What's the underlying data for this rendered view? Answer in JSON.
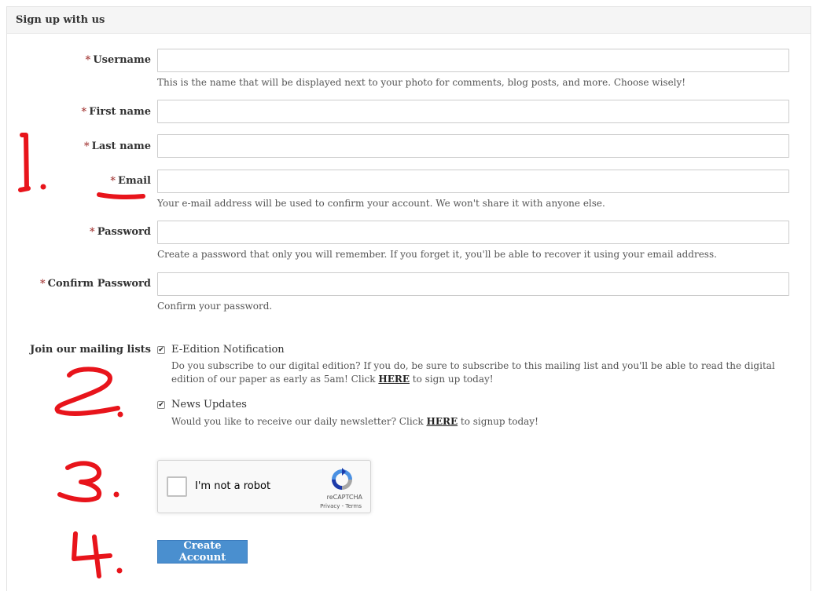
{
  "form": {
    "title": "Sign up with us",
    "required_marker": "*",
    "fields": {
      "username": {
        "label": "Username",
        "help": "This is the name that will be displayed next to your photo for comments, blog posts, and more. Choose wisely!",
        "value": ""
      },
      "first_name": {
        "label": "First name",
        "value": ""
      },
      "last_name": {
        "label": "Last name",
        "value": ""
      },
      "email": {
        "label": "Email",
        "help": "Your e-mail address will be used to confirm your account. We won't share it with anyone else.",
        "value": ""
      },
      "password": {
        "label": "Password",
        "help": "Create a password that only you will remember. If you forget it, you'll be able to recover it using your email address.",
        "value": ""
      },
      "confirm_password": {
        "label": "Confirm Password",
        "help": "Confirm your password.",
        "value": ""
      }
    },
    "mailing": {
      "label": "Join our mailing lists",
      "items": [
        {
          "label": "E-Edition Notification",
          "checked": true,
          "help_before": "Do you subscribe to our digital edition? If you do, be sure to subscribe to this mailing list and you'll be able to read the digital edition of our paper as early as 5am! Click ",
          "link": "HERE",
          "help_after": " to sign up today!"
        },
        {
          "label": "News Updates",
          "checked": true,
          "help_before": "Would you like to receive our daily newsletter? Click ",
          "link": "HERE",
          "help_after": " to signup today!"
        }
      ]
    },
    "recaptcha": {
      "text": "I'm not a robot",
      "brand": "reCAPTCHA",
      "links": "Privacy - Terms"
    },
    "submit_label": "Create Account",
    "checkmark": "✔"
  },
  "annotations": {
    "color": "#e8141b",
    "labels": [
      "1.",
      "2.",
      "3.",
      "4."
    ]
  }
}
